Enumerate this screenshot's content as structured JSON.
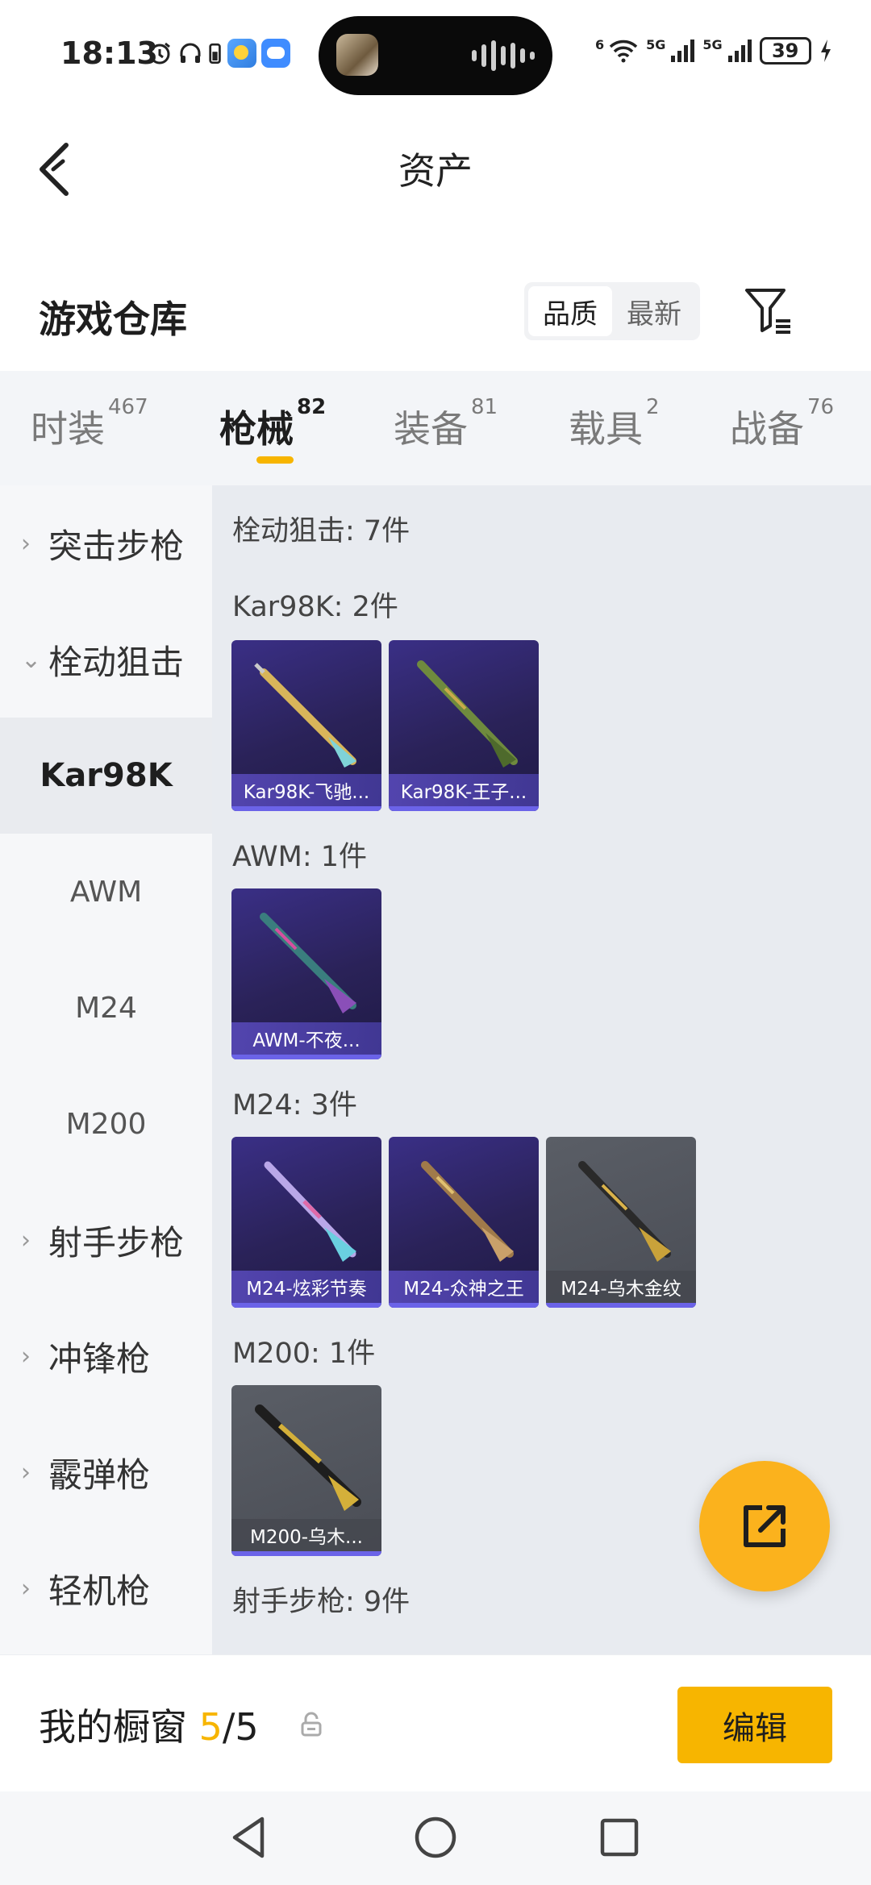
{
  "status_bar": {
    "time": "18:13",
    "battery": "39",
    "signal_label_1": "5G",
    "signal_label_2": "5G",
    "wifi_label": "6"
  },
  "header": {
    "title": "资产"
  },
  "warehouse": {
    "title": "游戏仓库",
    "sort_options": [
      "品质",
      "最新"
    ],
    "sort_selected": "品质"
  },
  "tabs": [
    {
      "label": "时装",
      "count": "467"
    },
    {
      "label": "枪械",
      "count": "82"
    },
    {
      "label": "装备",
      "count": "81"
    },
    {
      "label": "载具",
      "count": "2"
    },
    {
      "label": "战备",
      "count": "76"
    }
  ],
  "sidebar": {
    "items": [
      {
        "label": "突击步枪",
        "type": "group",
        "chevron": "›"
      },
      {
        "label": "栓动狙击",
        "type": "group",
        "chevron": "⌄"
      },
      {
        "label": "Kar98K",
        "type": "sub",
        "selected": true
      },
      {
        "label": "AWM",
        "type": "sub"
      },
      {
        "label": "M24",
        "type": "sub"
      },
      {
        "label": "M200",
        "type": "sub"
      },
      {
        "label": "射手步枪",
        "type": "group",
        "chevron": "›"
      },
      {
        "label": "冲锋枪",
        "type": "group",
        "chevron": "›"
      },
      {
        "label": "霰弹枪",
        "type": "group",
        "chevron": "›"
      },
      {
        "label": "轻机枪",
        "type": "group",
        "chevron": "›"
      }
    ]
  },
  "content": {
    "category_summary": "栓动狙击: 7件",
    "groups": [
      {
        "label": "Kar98K: 2件",
        "items": [
          {
            "name": "Kar98K-飞驰...",
            "rarity": "purple"
          },
          {
            "name": "Kar98K-王子...",
            "rarity": "purple"
          }
        ]
      },
      {
        "label": "AWM: 1件",
        "items": [
          {
            "name": "AWM-不夜...",
            "rarity": "purple"
          }
        ]
      },
      {
        "label": "M24: 3件",
        "items": [
          {
            "name": "M24-炫彩节奏",
            "rarity": "purple"
          },
          {
            "name": "M24-众神之王",
            "rarity": "purple"
          },
          {
            "name": "M24-乌木金纹",
            "rarity": "gray"
          }
        ]
      },
      {
        "label": "M200: 1件",
        "items": [
          {
            "name": "M200-乌木...",
            "rarity": "gray"
          }
        ]
      }
    ],
    "next_category": "射手步枪: 9件"
  },
  "showcase": {
    "title": "我的橱窗",
    "count_current": "5",
    "count_sep": "/",
    "count_total": "5",
    "edit_label": "编辑"
  },
  "colors": {
    "accent": "#f7b500",
    "fab": "#fbb21d",
    "rarity_purple": "#3a2f86",
    "rarity_gray": "#5a5e66"
  },
  "icons": {
    "back": "back-arrow-icon",
    "filter": "filter-icon",
    "share": "share-icon",
    "lock": "lock-icon",
    "nav_back": "triangle-back-icon",
    "nav_home": "circle-home-icon",
    "nav_recent": "square-recent-icon"
  }
}
